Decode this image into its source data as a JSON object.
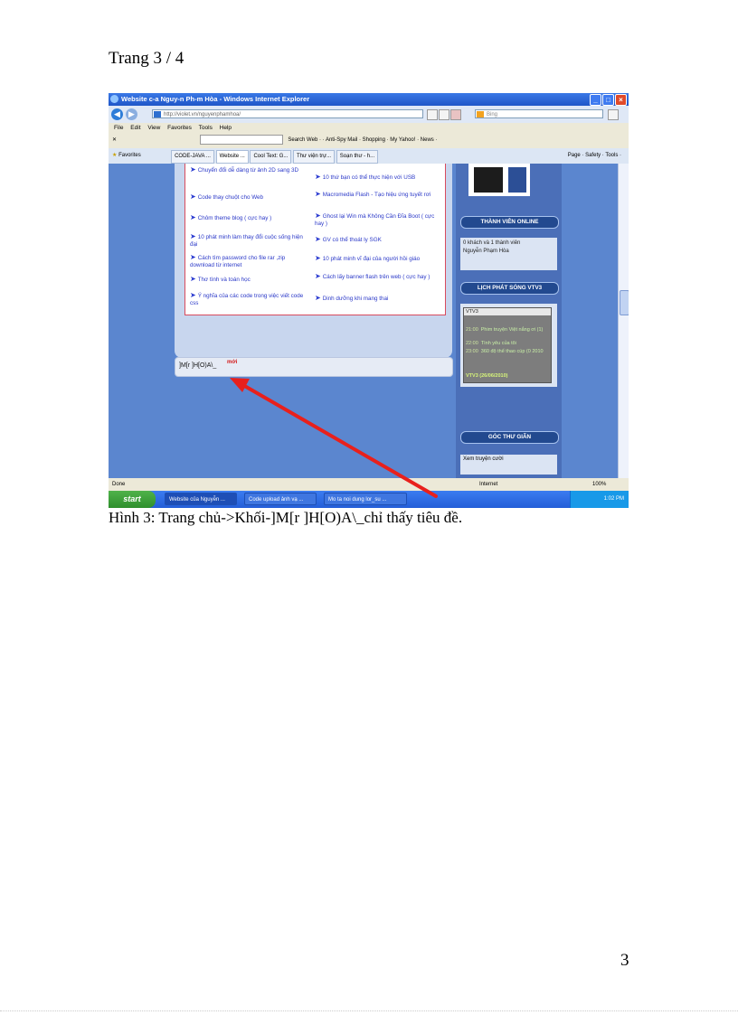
{
  "page": {
    "header": "Trang 3 / 4",
    "caption": "Hình 3: Trang chủ->Khối-]M[r ]H[O)A\\_chỉ thấy tiêu đề.",
    "page_number": "3"
  },
  "browser": {
    "title": "Website c-a Nguy-n Ph-m Hòa - Windows Internet Explorer",
    "address": "http://violet.vn/nguyenphamhoa/",
    "search_placeholder": "Bing",
    "menu": [
      "File",
      "Edit",
      "View",
      "Favorites",
      "Tools",
      "Help"
    ],
    "toolbar_text": "Search Web ·   ·   Anti-Spy   Mail ·   Shopping ·   My Yahoo! ·   News ·",
    "favorites_label": "Favorites",
    "tabs": [
      "CODE-JAVA ...",
      "Website ...",
      "Cool Text: G...",
      "Thư viện trự...",
      "Soạn thư - h..."
    ],
    "command_bar": "Page · Safety · Tools ·",
    "status_left": "Done",
    "status_zone": "Internet",
    "zoom": "100%"
  },
  "site": {
    "links_left": [
      "Chuyển đổi dễ dàng từ ảnh 2D sang 3D",
      "Code thay chuột cho Web",
      "Chôm theme blog ( cực hay )",
      "10 phát minh làm thay đổi cuộc sống hiện đại",
      "Cách tìm password cho file rar ,zip download từ internet",
      "Thơ tình và toán học",
      "Ý nghĩa của các code trong việc viết code css"
    ],
    "links_right": [
      "10 thứ bạn có thể thực hiện với USB",
      "Macromedia Flash - Tạo hiệu ứng tuyết rơi",
      "Ghost lại Win mà Không Cần Đĩa Boot ( cực hay )",
      "GV có thể thoát ly SGK",
      "10 phát minh vĩ đại của người hồi giáo",
      "Cách lấy banner flash trên web ( cực hay )",
      "Dinh dưỡng khi mang thai"
    ],
    "block_title": "]M[r ]H[O)A\\_",
    "block_new_badge": "mới",
    "online_title": "THÀNH VIÊN ONLINE",
    "online_text": "0 khách và 1 thành viên",
    "online_user": "Nguyễn Phạm Hòa",
    "tv_title": "LỊCH PHÁT SÓNG VTV3",
    "tv_channel": "VTV3",
    "tv_rows": [
      {
        "time": "21:00",
        "show": "Phim truyện Việt nắng ơi (1)"
      },
      {
        "time": "22:00",
        "show": "Tình yêu của tôi"
      },
      {
        "time": "23:00",
        "show": "360 độ thể thao cúp (0 2010"
      }
    ],
    "tv_footer": "VTV3 (26/06/2010)",
    "relax_title": "GÓC THƯ GIÃN",
    "relax_text": "Xem truyện cười"
  },
  "taskbar": {
    "start": "start",
    "buttons": [
      "Website của Nguyễn ...",
      "Code upload ảnh vạ ...",
      "Mo ta noi dung lor_su ..."
    ],
    "clock": "1:02 PM"
  },
  "colors": {
    "page_blue": "#5b86cf",
    "annotation_arrow": "#e8201c"
  }
}
